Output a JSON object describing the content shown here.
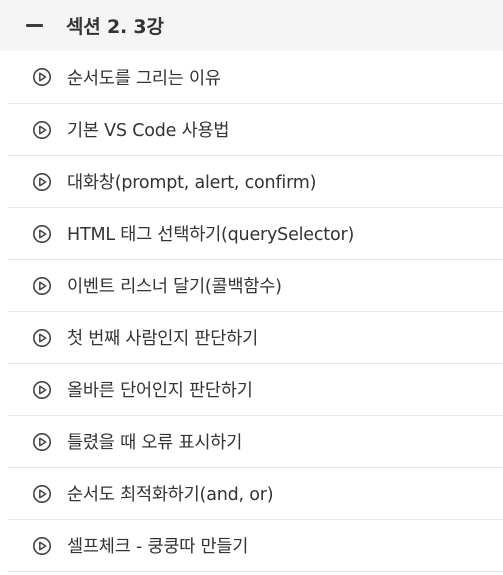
{
  "section": {
    "title": "섹션 2. 3강",
    "collapse_icon": "minus-icon",
    "lesson_icon": "play-circle-icon",
    "colors": {
      "header_bg": "#f5f5f5",
      "text": "#333333",
      "divider": "#e6e6e6"
    },
    "lessons": [
      {
        "title": "순서도를 그리는 이유"
      },
      {
        "title": "기본 VS Code 사용법"
      },
      {
        "title": "대화창(prompt, alert, confirm)"
      },
      {
        "title": "HTML 태그 선택하기(querySelector)"
      },
      {
        "title": "이벤트 리스너 달기(콜백함수)"
      },
      {
        "title": "첫 번째 사람인지 판단하기"
      },
      {
        "title": "올바른 단어인지 판단하기"
      },
      {
        "title": "틀렸을 때 오류 표시하기"
      },
      {
        "title": "순서도 최적화하기(and, or)"
      },
      {
        "title": "셀프체크 - 쿵쿵따 만들기"
      }
    ]
  }
}
